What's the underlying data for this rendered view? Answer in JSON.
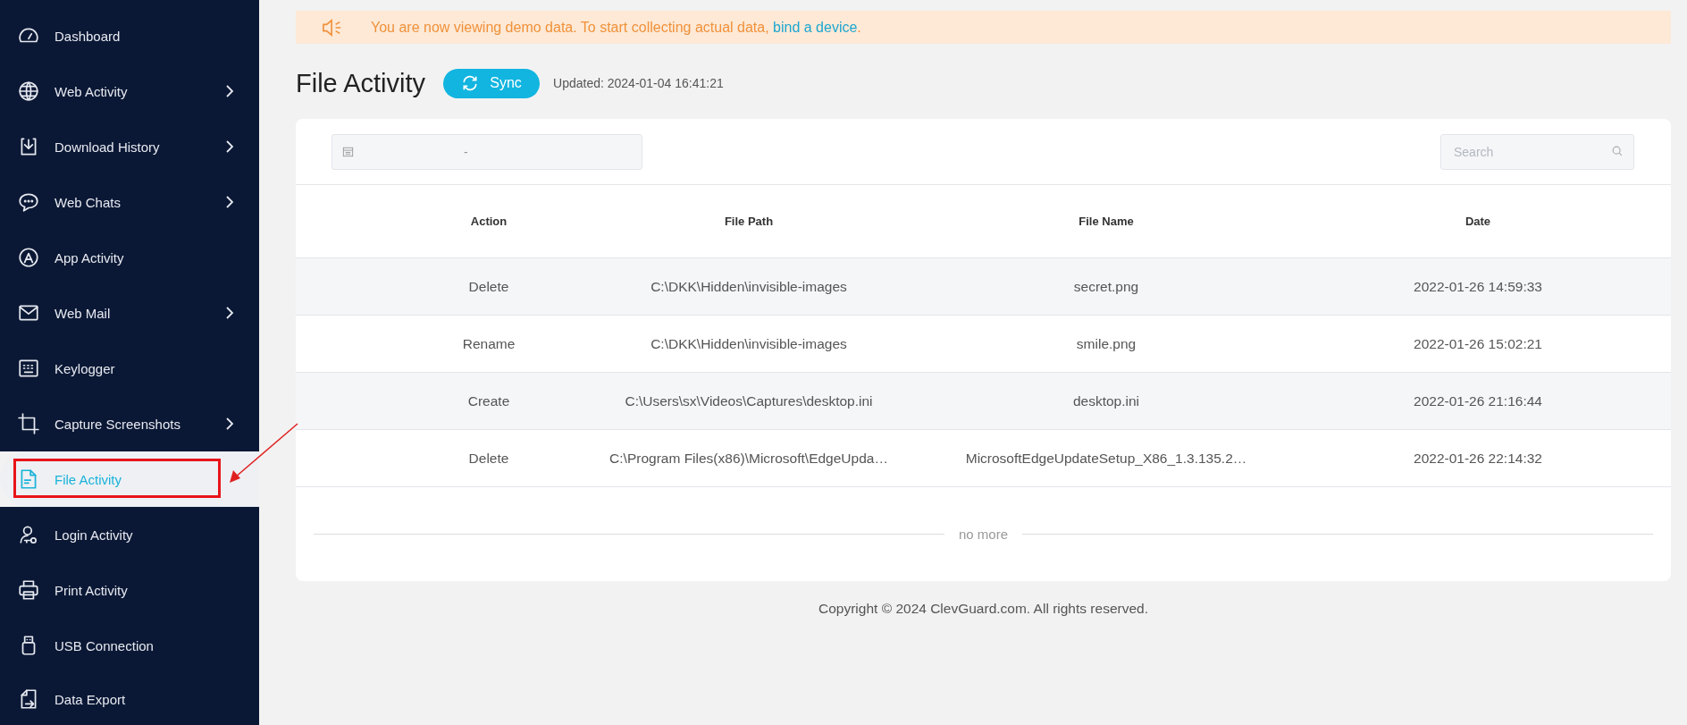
{
  "sidebar": {
    "items": [
      {
        "label": "Dashboard",
        "kind": "dashboard",
        "has_submenu": false,
        "selected": false
      },
      {
        "label": "Web Activity",
        "kind": "globe",
        "has_submenu": true,
        "selected": false
      },
      {
        "label": "Download History",
        "kind": "download",
        "has_submenu": true,
        "selected": false
      },
      {
        "label": "Web Chats",
        "kind": "chat",
        "has_submenu": true,
        "selected": false
      },
      {
        "label": "App Activity",
        "kind": "app",
        "has_submenu": false,
        "selected": false
      },
      {
        "label": "Web Mail",
        "kind": "mail",
        "has_submenu": true,
        "selected": false
      },
      {
        "label": "Keylogger",
        "kind": "keyboard",
        "has_submenu": false,
        "selected": false
      },
      {
        "label": "Capture Screenshots",
        "kind": "crop",
        "has_submenu": true,
        "selected": false
      },
      {
        "label": "File Activity",
        "kind": "file",
        "has_submenu": false,
        "selected": true
      },
      {
        "label": "Login Activity",
        "kind": "user",
        "has_submenu": false,
        "selected": false
      },
      {
        "label": "Print Activity",
        "kind": "printer",
        "has_submenu": false,
        "selected": false
      },
      {
        "label": "USB Connection",
        "kind": "usb",
        "has_submenu": false,
        "selected": false
      },
      {
        "label": "Data Export",
        "kind": "export",
        "has_submenu": false,
        "selected": false
      }
    ]
  },
  "banner": {
    "text": "You are now viewing demo data. To start collecting actual data,",
    "link": "bind a device",
    "end": "."
  },
  "header": {
    "title": "File Activity",
    "sync_button": "Sync",
    "updated": "Updated: 2024-01-04 16:41:21"
  },
  "filters": {
    "date_range_separator": "-",
    "search": {
      "placeholder": "Search"
    }
  },
  "table": {
    "columns": [
      "Action",
      "File Path",
      "File Name",
      "Date"
    ],
    "rows": [
      [
        "Delete",
        "C:\\DKK\\Hidden\\invisible-images",
        "secret.png",
        "2022-01-26 14:59:33"
      ],
      [
        "Rename",
        "C:\\DKK\\Hidden\\invisible-images",
        "smile.png",
        "2022-01-26 15:02:21"
      ],
      [
        "Create",
        "C:\\Users\\sx\\Videos\\Captures\\desktop.ini",
        "desktop.ini",
        "2022-01-26 21:16:44"
      ],
      [
        "Delete",
        "C:\\Program Files(x86)\\Microsoft\\EdgeUpda…",
        "MicrosoftEdgeUpdateSetup_X86_1.3.135.2…",
        "2022-01-26 22:14:32"
      ]
    ],
    "end_text": "no more"
  },
  "footer": "Copyright © 2024 ClevGuard.com. All rights reserved."
}
